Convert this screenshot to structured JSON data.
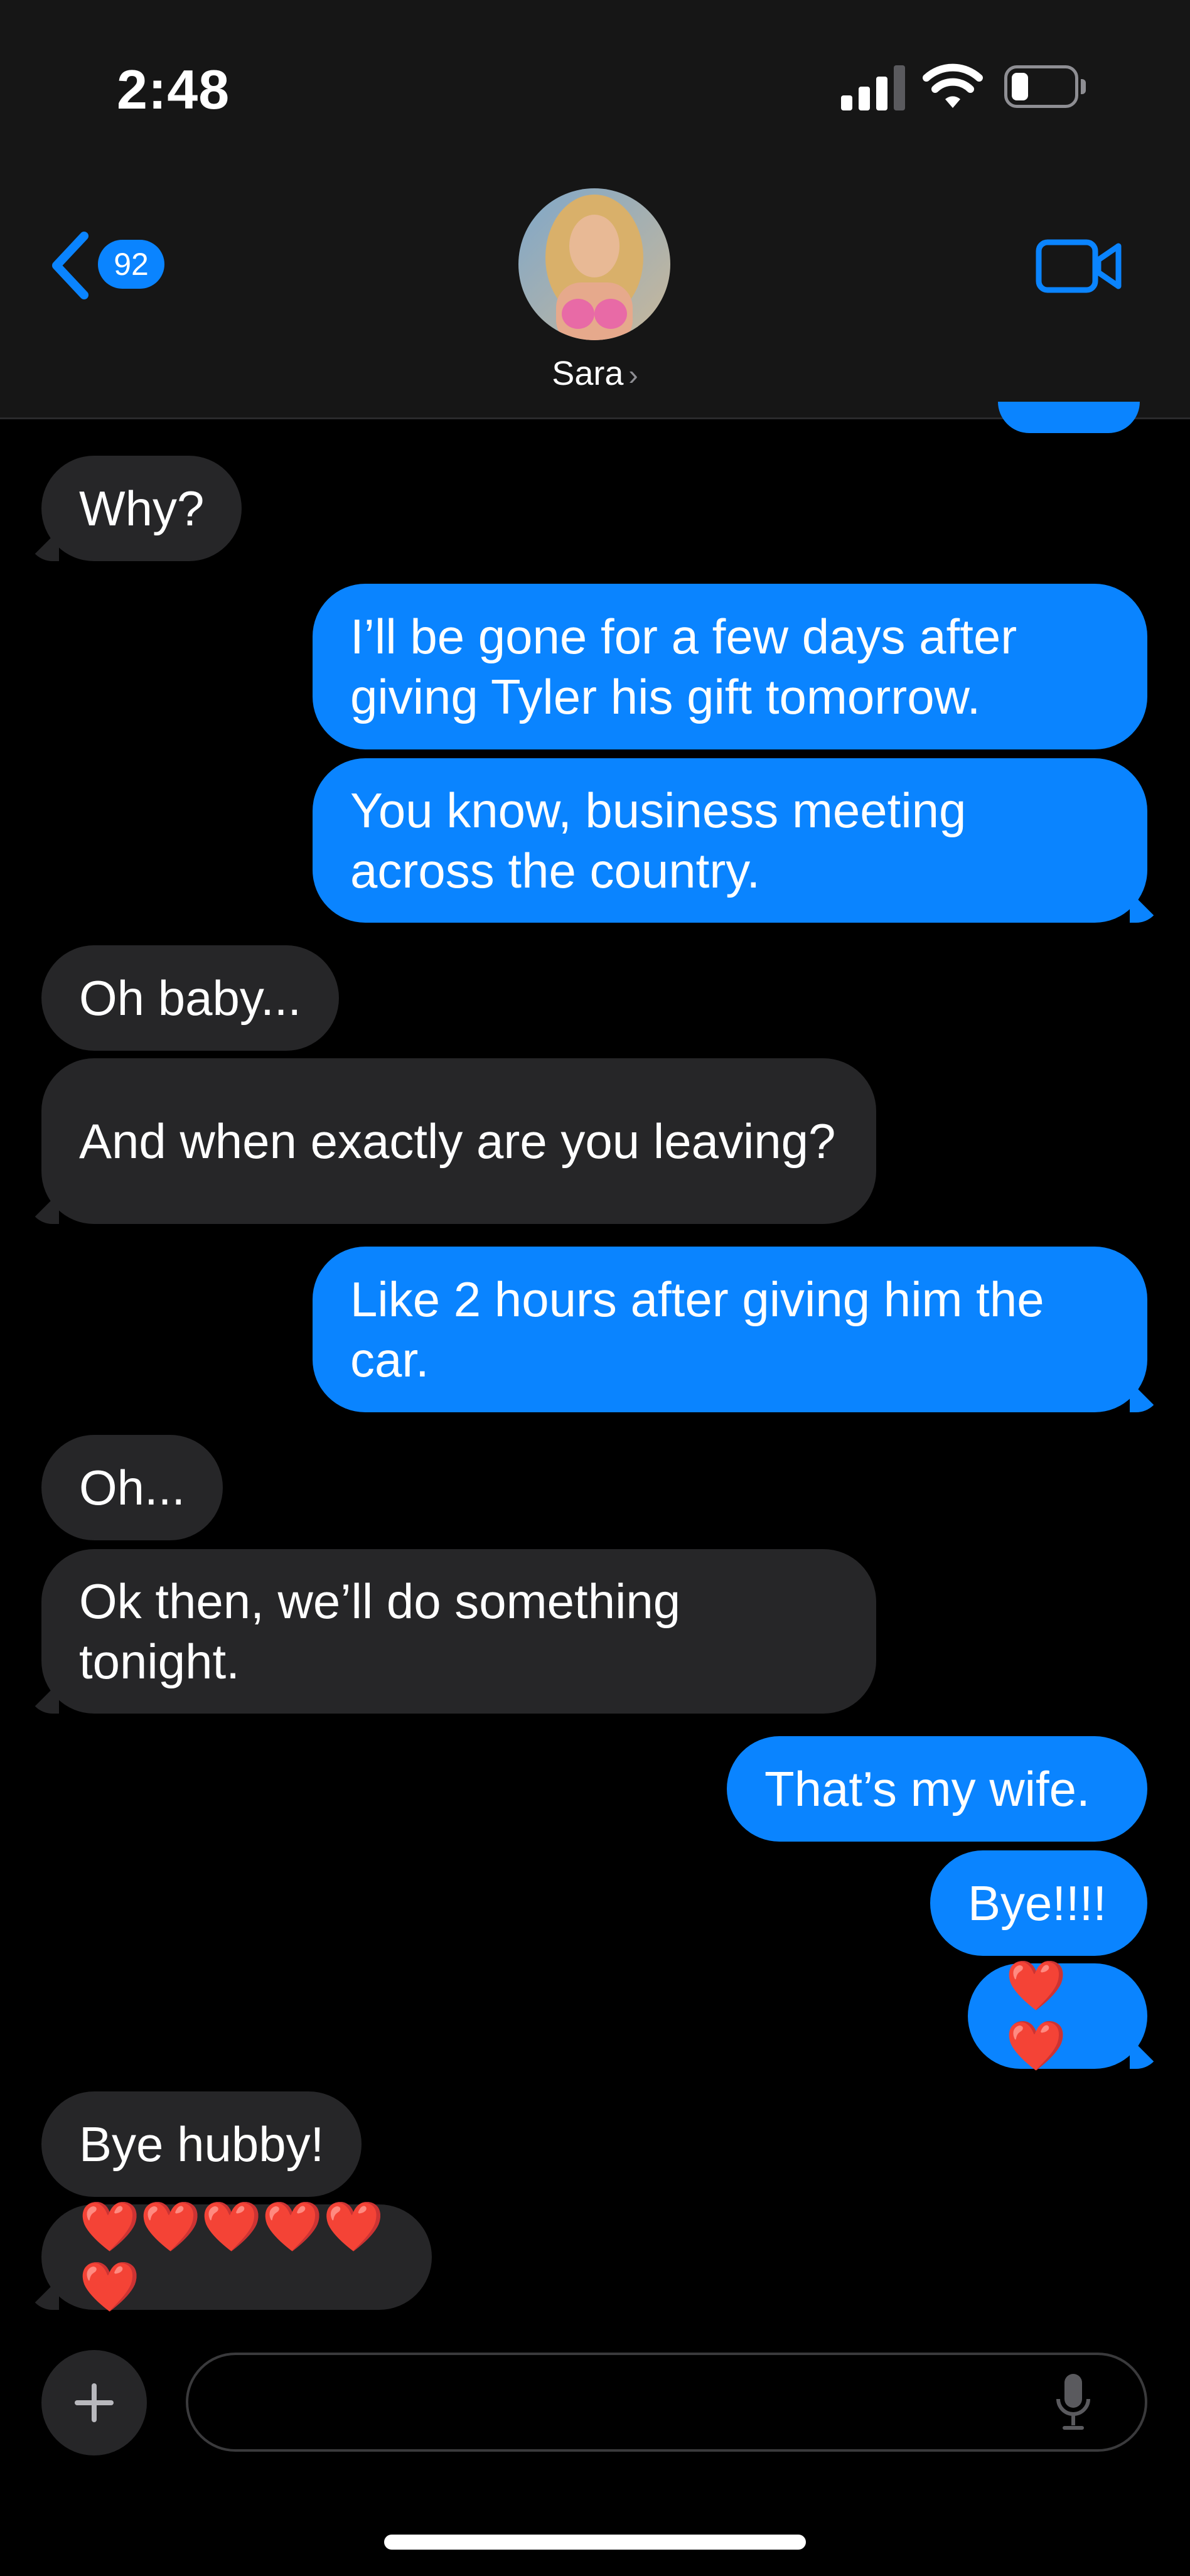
{
  "status": {
    "time": "2:48"
  },
  "header": {
    "back_badge": "92",
    "contact_name": "Sara",
    "contact_chevron": "›"
  },
  "messages": [
    {
      "text": "Why?"
    },
    {
      "text": "I’ll be gone for a few days after giving Tyler his gift tomorrow."
    },
    {
      "text": "You know, business meeting across the country."
    },
    {
      "text": "Oh baby..."
    },
    {
      "text": "And when exactly are you leaving?"
    },
    {
      "text": "Like 2 hours after giving him the car."
    },
    {
      "text": "Oh..."
    },
    {
      "text": "Ok then, we’ll do something tonight."
    },
    {
      "text": "That’s my wife."
    },
    {
      "text": "Bye!!!!"
    },
    {
      "text": "❤️❤️"
    },
    {
      "text": "Bye hubby!"
    },
    {
      "text": "❤️❤️❤️❤️❤️❤️"
    }
  ],
  "composer": {
    "placeholder": ""
  },
  "colors": {
    "sent_bubble": "#0a84ff",
    "received_bubble": "#262628",
    "background": "#000000"
  }
}
